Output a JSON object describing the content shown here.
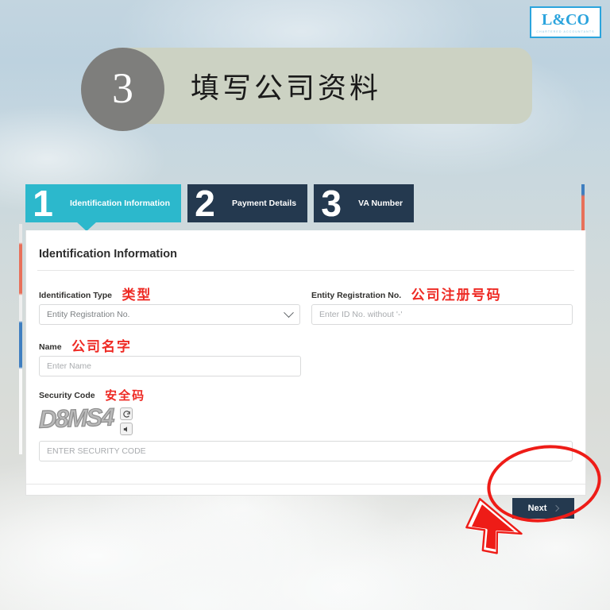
{
  "logo": {
    "name": "L&CO",
    "tagline": "CHARTERED ACCOUNTANTS",
    "accent_color": "#2ba4dd"
  },
  "banner": {
    "step_number": "3",
    "title": "填写公司资料",
    "pill_color": "#ccd2c3",
    "badge_color": "#7e7e7c"
  },
  "wizard": {
    "active_color": "#2cb8cc",
    "idle_color": "#24394f",
    "tabs": [
      {
        "number": "1",
        "label": "Identification Information",
        "active": true
      },
      {
        "number": "2",
        "label": "Payment Details",
        "active": false
      },
      {
        "number": "3",
        "label": "VA Number",
        "active": false
      }
    ]
  },
  "panel": {
    "title": "Identification Information",
    "fields": {
      "identification_type": {
        "label": "Identification Type",
        "annotation": "类型",
        "value": "Entity Registration No."
      },
      "entity_registration_no": {
        "label": "Entity Registration No.",
        "annotation": "公司注册号码",
        "placeholder": "Enter ID No. without '-'",
        "value": ""
      },
      "name": {
        "label": "Name",
        "annotation": "公司名字",
        "placeholder": "Enter Name",
        "value": ""
      },
      "security_code": {
        "label": "Security Code",
        "annotation": "安全码",
        "captcha_text": "D8MS4",
        "placeholder": "ENTER SECURITY CODE",
        "value": "",
        "refresh_icon": "refresh-icon",
        "audio_icon": "audio-icon"
      }
    },
    "next_button": {
      "label": "Next",
      "icon": "chevron-right-icon"
    }
  },
  "annotations": {
    "highlight_color": "#ee1c17",
    "cursor_icon": "mouse-cursor-arrow",
    "ellipse_target": "next-button"
  }
}
